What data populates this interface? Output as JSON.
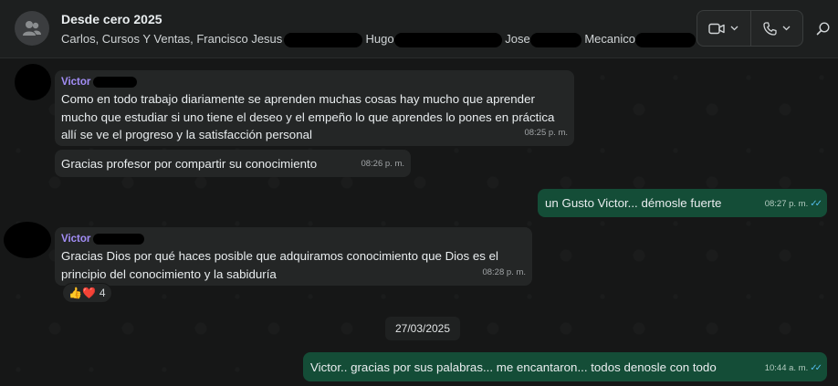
{
  "header": {
    "title": "Desde cero 2025",
    "members": [
      "Carlos, Cursos Y Ventas, Francisco Jesus",
      "Hugo",
      "Jose",
      "Mecanico"
    ],
    "video_icon": "video-camera-icon",
    "call_icon": "phone-icon",
    "search_icon": "search-icon"
  },
  "messages": [
    {
      "sender": "Victor",
      "text": "Como en todo trabajo diariamente se aprenden muchas cosas hay mucho que aprender mucho que estudiar si uno tiene el deseo y el empeño lo que aprendes lo pones en práctica allí se ve el progreso y la satisfacción personal",
      "time": "08:25 p. m."
    },
    {
      "text": "Gracias profesor por compartir su conocimiento",
      "time": "08:26 p. m."
    },
    {
      "text": "un Gusto Victor... démosle fuerte",
      "time": "08:27 p. m."
    },
    {
      "sender": "Victor",
      "text": "Gracias Dios por qué haces posible que adquiramos conocimiento que Dios es el principio del conocimiento y la sabiduría",
      "time": "08:28 p. m.",
      "reactions": {
        "emojis": "👍❤️",
        "count": "4"
      }
    },
    {
      "text": "Victor.. gracias por sus palabras... me encantaron... todos denosle con todo",
      "time": "10:44 a. m."
    }
  ],
  "date_separator": "27/03/2025",
  "colors": {
    "background": "#161717",
    "incoming_bubble": "#242626",
    "outgoing_bubble": "#144d37",
    "sender_name": "#a38ef7",
    "read_ticks": "#53bdeb"
  }
}
